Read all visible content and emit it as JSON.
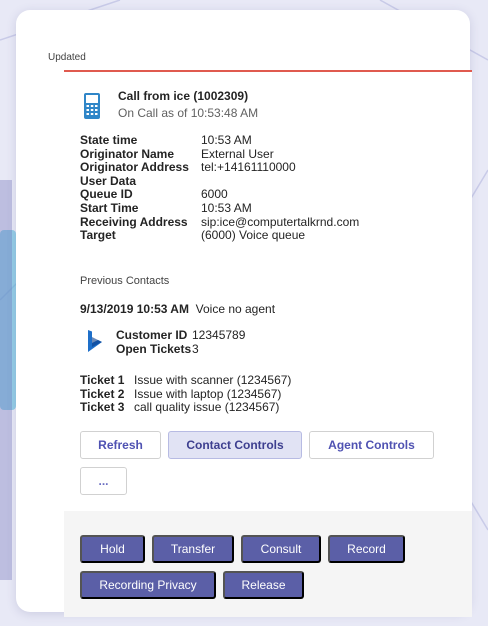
{
  "card": {
    "status": "Updated"
  },
  "call": {
    "title": "Call from ice (1002309)",
    "subtitle": "On Call as of 10:53:48 AM",
    "accent_color": "#e05a4f"
  },
  "info": [
    {
      "key": "State time",
      "value": "10:53 AM"
    },
    {
      "key": "Originator Name",
      "value": "External User"
    },
    {
      "key": "Originator Address",
      "value": "tel:+14161110000"
    },
    {
      "key": "User Data",
      "value": ""
    },
    {
      "key": "Queue ID",
      "value": "6000"
    },
    {
      "key": "Start Time",
      "value": "10:53 AM"
    },
    {
      "key": "Receiving Address",
      "value": "sip:ice@computertalkrnd.com"
    },
    {
      "key": "Target",
      "value": "(6000) Voice queue"
    }
  ],
  "previous": {
    "label": "Previous Contacts",
    "date": "9/13/2019 10:53 AM",
    "description": "Voice no agent"
  },
  "customer": [
    {
      "key": "Customer ID",
      "value": "12345789"
    },
    {
      "key": "Open Tickets",
      "value": "3"
    }
  ],
  "tickets": [
    {
      "key": "Ticket 1",
      "value": "Issue with scanner (1234567)"
    },
    {
      "key": "Ticket 2",
      "value": "Issue with laptop (1234567)"
    },
    {
      "key": "Ticket 3",
      "value": "call quality issue (1234567)"
    }
  ],
  "controls": {
    "refresh": "Refresh",
    "contact_controls": "Contact Controls",
    "agent_controls": "Agent Controls",
    "more": "..."
  },
  "actions": {
    "hold": "Hold",
    "transfer": "Transfer",
    "consult": "Consult",
    "record": "Record",
    "recording_privacy": "Recording Privacy",
    "release": "Release",
    "color": "#5b5fa7"
  },
  "icons": {
    "call": "phone-icon",
    "crm": "dynamics-icon"
  }
}
